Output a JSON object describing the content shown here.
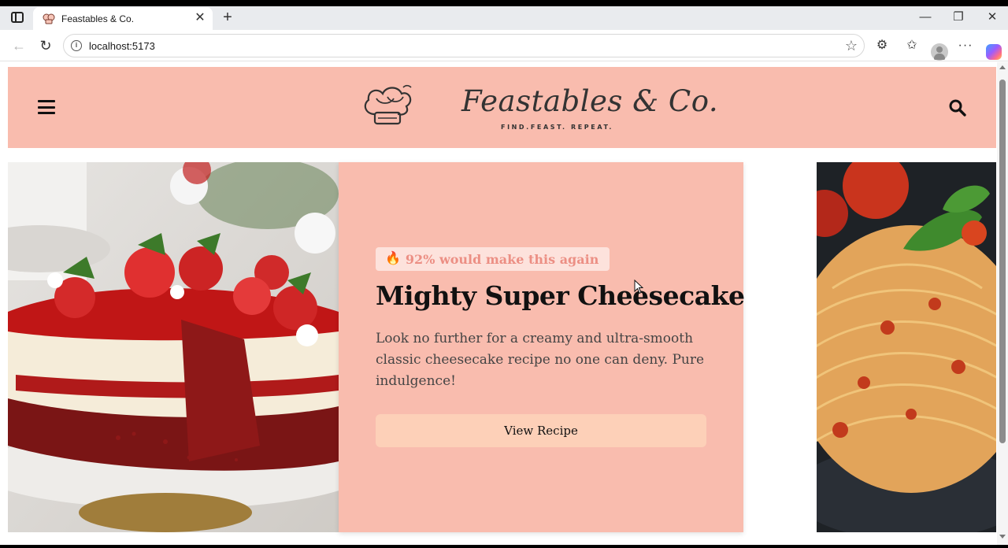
{
  "browser": {
    "tab_title": "Feastables & Co.",
    "tab_close_glyph": "✕",
    "new_tab_glyph": "+",
    "url": "localhost:5173",
    "window_controls": {
      "minimize": "—",
      "restore": "❐",
      "close": "✕"
    },
    "icons": [
      "sidebar-toggle-icon",
      "back-icon",
      "reload-icon",
      "info-icon",
      "favorite-star-icon",
      "extensions-icon",
      "favorites-icon",
      "profile-avatar",
      "more-icon",
      "copilot-icon"
    ]
  },
  "header": {
    "brand_name": "Feastables & Co.",
    "tagline": "FIND.FEAST. REPEAT.",
    "icons": [
      "menu-icon",
      "chef-hat-logo",
      "search-icon"
    ],
    "background_color": "#f9bcae"
  },
  "hero": {
    "badge_icon": "🔥",
    "badge_text": "92% would make this again",
    "title": "Mighty Super Cheesecake",
    "description": "Look no further for a creamy and ultra-smooth classic cheesecake recipe no one can deny. Pure indulgence!",
    "button_label": "View Recipe",
    "left_image": "red-velvet-cheesecake-with-strawberries",
    "next_image": "spaghetti-with-tomato-sauce-and-basil",
    "colors": {
      "card": "#f9bcae",
      "badge_bg": "#fde2dc",
      "badge_text": "#ec8f84",
      "button": "#fdd0b8"
    }
  }
}
